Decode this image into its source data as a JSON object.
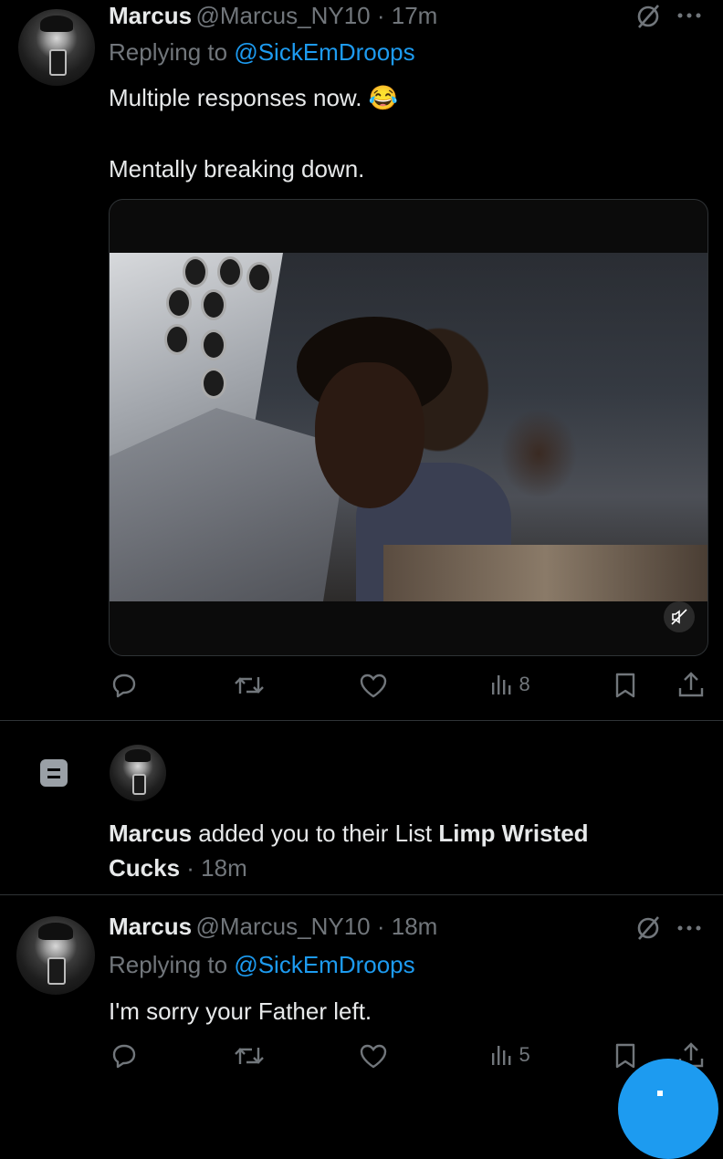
{
  "tweet1": {
    "name": "Marcus",
    "handle": "@Marcus_NY10",
    "sep": " · ",
    "time": "17m",
    "replying_prefix": "Replying to ",
    "replying_to": "@SickEmDroops",
    "text_line1": "Multiple responses now. 😂",
    "text_line2": "Mentally breaking down.",
    "actions": {
      "views": "8"
    }
  },
  "notification": {
    "name": "Marcus",
    "middle": " added you to their List ",
    "list_name_part1": "Limp Wristed",
    "list_name_part2": "Cucks",
    "sep": " · ",
    "time": "18m"
  },
  "tweet2": {
    "name": "Marcus",
    "handle": "@Marcus_NY10",
    "sep": " · ",
    "time": "18m",
    "replying_prefix": "Replying to ",
    "replying_to": "@SickEmDroops",
    "text": "I'm sorry your Father left.",
    "actions": {
      "views": "5"
    }
  },
  "colors": {
    "accent": "#1d9bf0",
    "muted": "#71767b",
    "text": "#e7e9ea",
    "background": "#000000"
  },
  "icons": [
    "grok-slash-icon",
    "more-icon",
    "reply-icon",
    "retweet-icon",
    "like-icon",
    "views-icon",
    "bookmark-icon",
    "share-icon",
    "mute-icon",
    "list-icon"
  ]
}
